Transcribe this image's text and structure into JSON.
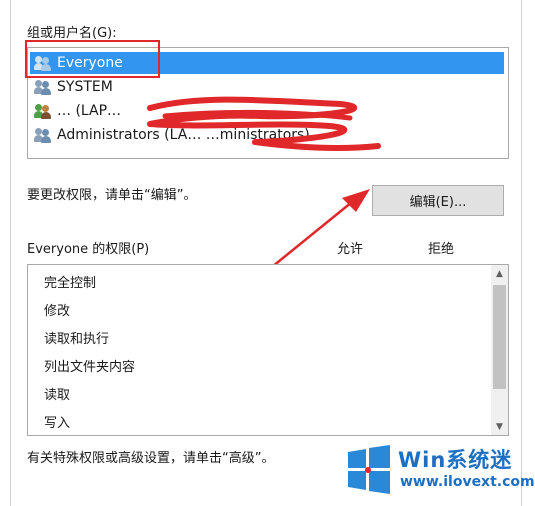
{
  "groups": {
    "label": "组或用户名(G):",
    "items": [
      {
        "name": "Everyone",
        "icon": "group-icon",
        "selected": true
      },
      {
        "name": "SYSTEM",
        "icon": "group-icon",
        "selected": false
      },
      {
        "name": "… (LAP…",
        "icon": "user-icon",
        "selected": false
      },
      {
        "name": "Administrators (LA…                    …ministrators)",
        "icon": "group-icon",
        "selected": false
      }
    ]
  },
  "change_hint": "要更改权限，请单击“编辑”。",
  "edit_button": "编辑(E)...",
  "permissions": {
    "title": "Everyone 的权限(P)",
    "allow_header": "允许",
    "deny_header": "拒绝",
    "items": [
      "完全控制",
      "修改",
      "读取和执行",
      "列出文件夹内容",
      "读取",
      "写入"
    ]
  },
  "advanced_hint": "有关特殊权限或高级设置，请单击“高级”。",
  "watermark": {
    "title": "Win系统迷",
    "url": "www.ilovext.com"
  },
  "colors": {
    "selection": "#3296f0",
    "annotation_red": "#e0272a",
    "watermark_blue": "#1d6fc4"
  }
}
